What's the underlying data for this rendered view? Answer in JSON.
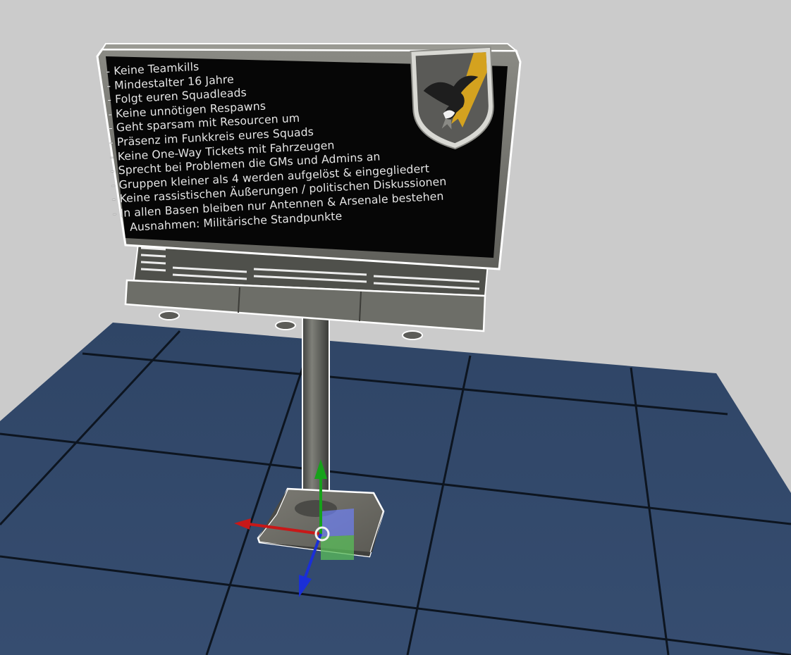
{
  "billboard": {
    "rules": [
      {
        "text": "- Keine Teamkills",
        "indent": false
      },
      {
        "text": "- Mindestalter 16 Jahre",
        "indent": false
      },
      {
        "text": "- Folgt euren Squadleads",
        "indent": false
      },
      {
        "text": "- Keine unnötigen Respawns",
        "indent": false
      },
      {
        "text": "- Geht sparsam mit Resourcen um",
        "indent": false
      },
      {
        "text": "- Präsenz im Funkkreis eures Squads",
        "indent": false
      },
      {
        "text": "- Keine One-Way Tickets mit Fahrzeugen",
        "indent": false
      },
      {
        "text": "- Sprecht bei Problemen die GMs und Admins an",
        "indent": false
      },
      {
        "text": "- Gruppen kleiner als 4 werden aufgelöst & eingegliedert",
        "indent": false
      },
      {
        "text": "- Keine rassistischen Äußerungen / politischen Diskussionen",
        "indent": false
      },
      {
        "text": "- In allen Basen bleiben nur Antennen & Arsenale bestehen",
        "indent": false
      },
      {
        "text": "Ausnahmen: Militärische Standpunkte",
        "indent": true
      }
    ],
    "crest_icon": "eagle-lightning-shield-icon"
  },
  "gizmo": {
    "x_axis_color": "#c81818",
    "y_axis_color": "#16a21a",
    "z_axis_color": "#1a2fd8",
    "center_color": "#f2f2f2"
  },
  "scene": {
    "background_color": "#cbcbcb",
    "floor_color": "#33496a",
    "grid_line_color": "#0d1520",
    "selection_outline_color": "#ffffff"
  }
}
